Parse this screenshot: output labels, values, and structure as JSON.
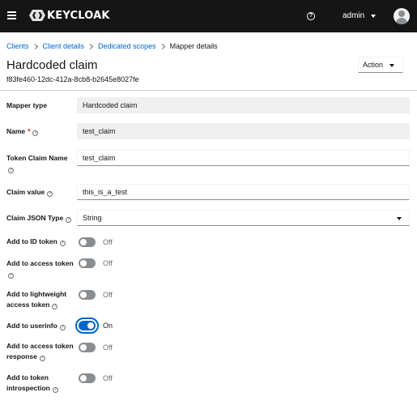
{
  "masthead": {
    "brand": "KEYCLOAK",
    "user": "admin"
  },
  "breadcrumb": [
    "Clients",
    "Client details",
    "Dedicated scopes",
    "Mapper details"
  ],
  "page": {
    "title": "Hardcoded claim",
    "subtitle": "f83fe460-12dc-412a-8cb8-b2645e8027fe",
    "action_label": "Action"
  },
  "form": {
    "mapper_type": {
      "label": "Mapper type",
      "value": "Hardcoded claim"
    },
    "name": {
      "label": "Name",
      "required": "*",
      "value": "test_claim"
    },
    "token_claim_name": {
      "label": "Token Claim Name",
      "value": "test_claim"
    },
    "claim_value": {
      "label": "Claim value",
      "value": "this_is_a_test"
    },
    "claim_json_type": {
      "label": "Claim JSON Type",
      "value": "String"
    },
    "switches": [
      {
        "label_1": "Add to ID token",
        "label_2": "",
        "state": "Off"
      },
      {
        "label_1": "Add to access token",
        "label_2": "",
        "state": "Off"
      },
      {
        "label_1": "Add to lightweight",
        "label_2": "access token",
        "state": "Off"
      },
      {
        "label_1": "Add to userinfo",
        "label_2": "",
        "state": "On"
      },
      {
        "label_1": "Add to access token",
        "label_2": "response",
        "state": "Off"
      },
      {
        "label_1": "Add to token",
        "label_2": "introspection",
        "state": "Off"
      }
    ]
  },
  "colors": {
    "masthead": "#151515",
    "link": "#0066cc",
    "switch_on": "#0066cc",
    "switch_off": "#8a8d90",
    "required": "#c9190b"
  }
}
